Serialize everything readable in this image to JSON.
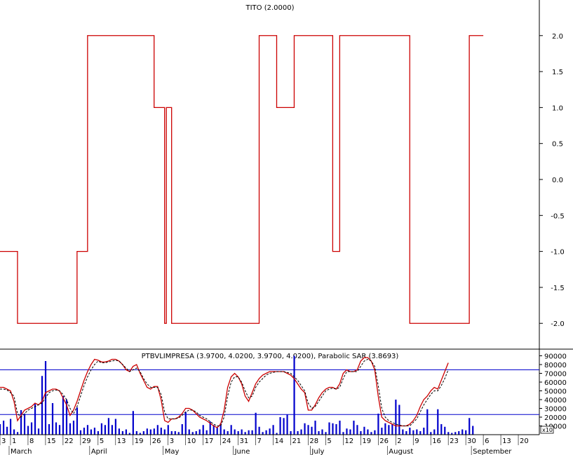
{
  "chart_data": [
    {
      "type": "line",
      "title": "TITO (2.0000)",
      "ylim": [
        -2.3,
        2.3
      ],
      "y_ticks": [
        "2.0",
        "1.5",
        "1.0",
        "0.5",
        "0.0",
        "-0.5",
        "-1.0",
        "-1.5",
        "-2.0"
      ],
      "y_tick_values": [
        2.0,
        1.5,
        1.0,
        0.5,
        0.0,
        -0.5,
        -1.0,
        -1.5,
        -2.0
      ],
      "grid": false,
      "series": [
        {
          "color": "#cc0000",
          "x": [
            0,
            4,
            5,
            21,
            22,
            24,
            25,
            43,
            44,
            45,
            46,
            47,
            47.5,
            48,
            48.5,
            49,
            50,
            70,
            74,
            75,
            79,
            80,
            84,
            85,
            95,
            96,
            97,
            98,
            99,
            116,
            117,
            133,
            134,
            138
          ],
          "y": [
            -1.0,
            -1.0,
            -2.0,
            -2.0,
            -1.0,
            -1.0,
            2.0,
            2.0,
            1.0,
            1.0,
            1.0,
            -2.0,
            1.0,
            1.0,
            1.0,
            -2.0,
            -2.0,
            -2.0,
            2.0,
            2.0,
            1.0,
            1.0,
            2.0,
            2.0,
            -1.0,
            -1.0,
            2.0,
            2.0,
            2.0,
            2.0,
            -2.0,
            -2.0,
            2.0,
            2.0
          ]
        }
      ]
    },
    {
      "type": "bar",
      "title": "PTBVLIMPRESA (3.9700, 4.0200, 3.9700, 4.0200), Parabolic SAR (3.8693)",
      "ylim": [
        0,
        92000
      ],
      "y_ticks": [
        "90000",
        "80000",
        "70000",
        "60000",
        "50000",
        "40000",
        "30000",
        "20000",
        "10000"
      ],
      "y_tick_values": [
        90000,
        80000,
        70000,
        60000,
        50000,
        40000,
        30000,
        20000,
        10000
      ],
      "y_multiplier_label": "x10",
      "bar_color": "#0000cc",
      "volume": [
        12000,
        16000,
        9000,
        18000,
        6000,
        3000,
        28000,
        24000,
        10000,
        14000,
        35000,
        7000,
        67000,
        84000,
        12000,
        36000,
        14000,
        11000,
        44000,
        40000,
        13000,
        16000,
        31000,
        5000,
        8000,
        11000,
        6000,
        8000,
        4000,
        13000,
        11000,
        19000,
        11000,
        18000,
        7000,
        4000,
        6000,
        2000,
        27000,
        4000,
        2000,
        4000,
        7000,
        6000,
        7000,
        11000,
        8000,
        6000,
        11000,
        4000,
        4000,
        3000,
        12000,
        26000,
        6000,
        3000,
        4000,
        6000,
        11000,
        5000,
        15000,
        11000,
        8000,
        13000,
        6000,
        4000,
        11000,
        6000,
        4000,
        6000,
        3000,
        5000,
        5000,
        25000,
        9000,
        3000,
        5000,
        7000,
        11000,
        2000,
        20000,
        19000,
        23000,
        4000,
        90000,
        4000,
        6000,
        13000,
        11000,
        9000,
        16000,
        4000,
        6000,
        3000,
        14000,
        13000,
        12000,
        16000,
        3000,
        7000,
        6000,
        16000,
        11000,
        4000,
        9000,
        6000,
        3000,
        5000,
        24000,
        8000,
        13000,
        11000,
        12000,
        40000,
        34000,
        6000,
        4000,
        8000,
        5000,
        6000,
        4000,
        8000,
        29000,
        3000,
        6000,
        29000,
        12000,
        9000,
        3000,
        2000,
        3000,
        4000,
        6000,
        5000,
        19000,
        10000
      ],
      "price_line": [
        54000,
        54000,
        52000,
        50000,
        38000,
        16000,
        22000,
        28000,
        30000,
        32000,
        36000,
        34000,
        38000,
        48000,
        50000,
        52000,
        52000,
        50000,
        42000,
        34000,
        22000,
        28000,
        38000,
        50000,
        62000,
        72000,
        80000,
        86000,
        85000,
        83000,
        83000,
        84000,
        86000,
        86000,
        84000,
        80000,
        74000,
        72000,
        78000,
        80000,
        70000,
        62000,
        54000,
        52000,
        55000,
        55000,
        40000,
        16000,
        14000,
        18000,
        18000,
        20000,
        24000,
        30000,
        30000,
        28000,
        24000,
        20000,
        18000,
        16000,
        13000,
        10000,
        8000,
        12000,
        28000,
        54000,
        66000,
        70000,
        66000,
        58000,
        44000,
        38000,
        48000,
        58000,
        64000,
        68000,
        70000,
        72000,
        72000,
        72000,
        72000,
        72000,
        70000,
        68000,
        64000,
        58000,
        52000,
        48000,
        28000,
        28000,
        34000,
        42000,
        48000,
        52000,
        54000,
        54000,
        52000,
        58000,
        70000,
        74000,
        72000,
        72000,
        74000,
        84000,
        88000,
        88000,
        84000,
        74000,
        44000,
        20000,
        16000,
        14000,
        12000,
        10000,
        10000,
        10000,
        10000,
        12000,
        16000,
        22000,
        32000,
        40000,
        44000,
        50000,
        54000,
        52000,
        62000,
        72000,
        82000
      ],
      "sar_line": [
        52000,
        52000,
        51000,
        48000,
        44000,
        24000,
        20000,
        24000,
        28000,
        30000,
        32000,
        34000,
        36000,
        42000,
        48000,
        50000,
        51000,
        50000,
        46000,
        40000,
        30000,
        24000,
        32000,
        44000,
        56000,
        66000,
        74000,
        80000,
        84000,
        82000,
        82000,
        83000,
        84000,
        85000,
        84000,
        80000,
        76000,
        72000,
        74000,
        76000,
        72000,
        64000,
        58000,
        54000,
        54000,
        54000,
        46000,
        26000,
        18000,
        18000,
        18000,
        19000,
        22000,
        26000,
        28000,
        28000,
        26000,
        22000,
        20000,
        18000,
        15000,
        12000,
        10000,
        10000,
        20000,
        44000,
        60000,
        66000,
        66000,
        60000,
        50000,
        42000,
        44000,
        54000,
        60000,
        64000,
        68000,
        70000,
        71000,
        72000,
        72000,
        72000,
        71000,
        70000,
        66000,
        62000,
        56000,
        50000,
        36000,
        30000,
        32000,
        38000,
        44000,
        50000,
        52000,
        53000,
        52000,
        54000,
        64000,
        72000,
        72000,
        72000,
        72000,
        78000,
        84000,
        86000,
        84000,
        78000,
        56000,
        30000,
        20000,
        16000,
        14000,
        12000,
        11000,
        10000,
        10000,
        10000,
        14000,
        18000,
        26000,
        34000,
        40000,
        46000,
        50000,
        50000,
        56000,
        64000,
        74000
      ],
      "hlines": [
        74000,
        23000
      ],
      "hline_color": "#0000cc",
      "price_color": "#cc0000",
      "sar_color": "#000000"
    }
  ],
  "x_axis": {
    "day_labels": [
      "3",
      "1",
      "8",
      "15",
      "22",
      "29",
      "5",
      "13",
      "19",
      "26",
      "3",
      "10",
      "17",
      "24",
      "31",
      "7",
      "14",
      "21",
      "28",
      "5",
      "12",
      "19",
      "26",
      "2",
      "9",
      "16",
      "23",
      "30",
      "6",
      "13",
      "20"
    ],
    "day_positions": [
      0,
      3,
      8,
      13,
      18,
      23,
      28,
      33,
      38,
      43,
      48,
      53,
      58,
      63,
      68,
      73,
      78,
      83,
      88,
      93,
      98,
      103,
      108,
      113,
      118,
      123,
      128,
      133,
      138,
      143,
      148
    ],
    "month_labels": [
      "March",
      "April",
      "May",
      "June",
      "July",
      "August",
      "September"
    ],
    "month_positions": [
      3,
      26,
      47,
      67,
      89,
      111,
      135
    ]
  }
}
